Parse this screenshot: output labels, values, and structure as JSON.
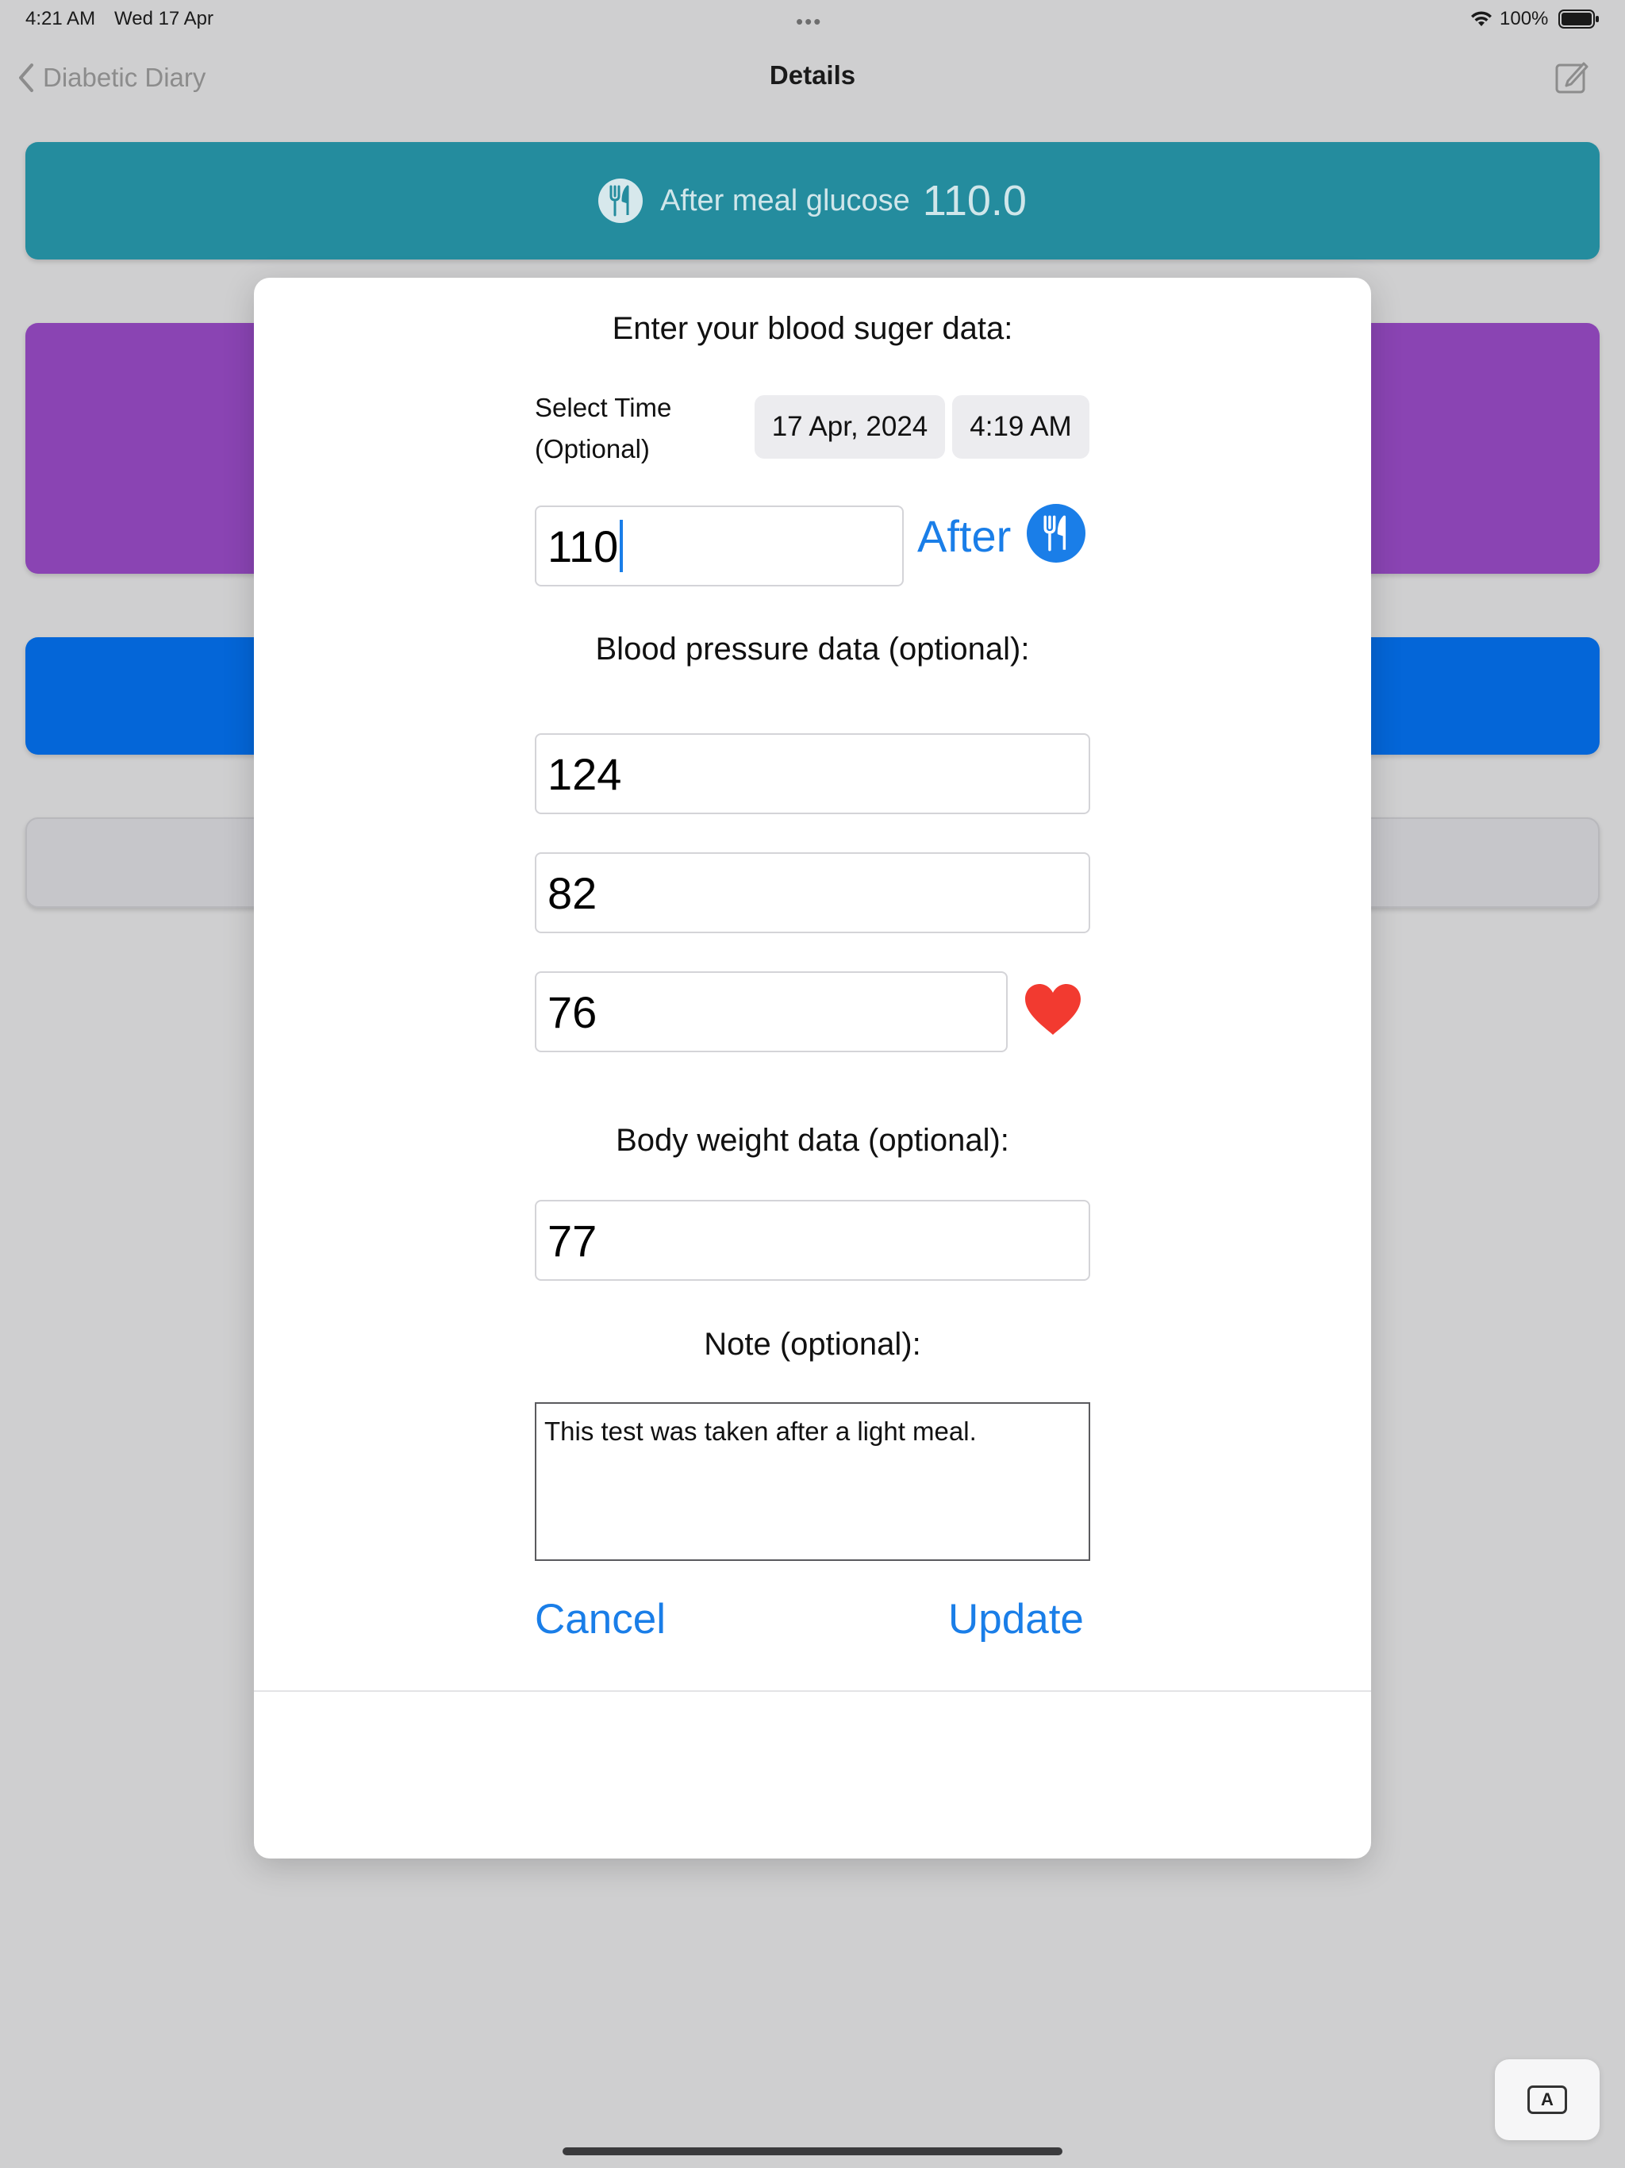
{
  "status_bar": {
    "time": "4:21 AM",
    "date": "Wed 17 Apr",
    "battery": "100%",
    "dots": "•••"
  },
  "nav": {
    "back_label": "Diabetic Diary",
    "title": "Details"
  },
  "summary_card": {
    "label": "After meal glucose",
    "value": "110.0"
  },
  "form": {
    "heading": "Enter your blood suger data:",
    "select_time_line1": "Select Time",
    "select_time_line2": "(Optional)",
    "date": "17 Apr, 2024",
    "time": "4:19 AM",
    "glucose_value": "110",
    "meal_state": "After",
    "bp_heading": "Blood pressure data (optional):",
    "systolic": "124",
    "diastolic": "82",
    "pulse": "76",
    "weight_heading": "Body weight data (optional):",
    "weight": "77",
    "note_heading": "Note (optional):",
    "note": "This test was taken after a light meal.",
    "cancel_label": "Cancel",
    "update_label": "Update"
  },
  "keyboard_toggle_label": "A",
  "colors": {
    "accent": "#1a7ee8",
    "teal_card": "#248c9e",
    "purple_card": "#8a44b3",
    "blue_card": "#0466d8",
    "heart": "#f23a30"
  }
}
